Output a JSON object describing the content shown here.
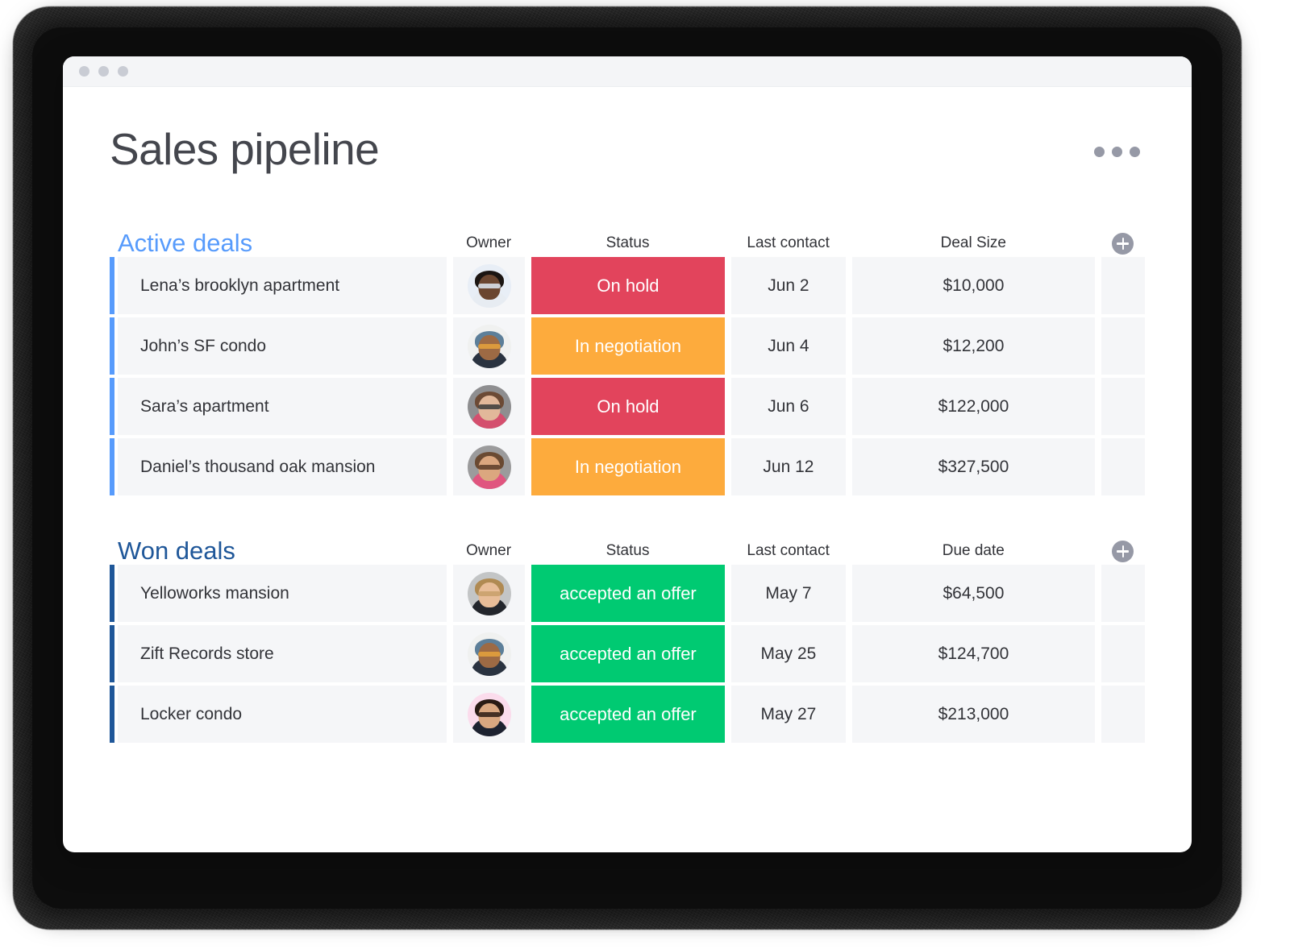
{
  "window": {
    "traffic_lights": [
      "close",
      "minimize",
      "maximize"
    ]
  },
  "header": {
    "title": "Sales pipeline",
    "menu_icon": "kebab-menu-icon"
  },
  "colors": {
    "active_accent": "#579bfc",
    "won_accent": "#1f5799",
    "status_on_hold": "#e2445c",
    "status_in_negotiation": "#fdab3d",
    "status_accepted": "#00ca72",
    "row_background": "#f5f6f8",
    "text": "#323338",
    "title_text": "#44464d",
    "icon_gray": "#9699a6"
  },
  "boards": [
    {
      "id": "active-deals",
      "title": "Active deals",
      "accent": "#579bfc",
      "add_label": "add-item-icon",
      "columns": [
        "Owner",
        "Status",
        "Last contact",
        "Deal Size"
      ],
      "rows": [
        {
          "name": "Lena’s brooklyn apartment",
          "owner": "owner-avatar-lena",
          "status": "On hold",
          "status_key": "onhold",
          "last_contact": "Jun 2",
          "value": "$10,000",
          "avatar": {
            "bg": "#e8eef6",
            "hair": "#1b1512",
            "face": "#6b4630",
            "body": "#e7ecf2",
            "acc": "#dfe9f2"
          }
        },
        {
          "name": "John’s SF condo",
          "owner": "owner-avatar-john",
          "status": "In negotiation",
          "status_key": "negot",
          "last_contact": "Jun 4",
          "value": "$12,200",
          "avatar": {
            "bg": "#f0f1f0",
            "hair": "#5d7f99",
            "face": "#9d6a44",
            "body": "#2a3340",
            "acc": "#e6a23c"
          }
        },
        {
          "name": "Sara’s apartment",
          "owner": "owner-avatar-sara",
          "status": "On hold",
          "status_key": "onhold",
          "last_contact": "Jun 6",
          "value": "$122,000",
          "avatar": {
            "bg": "#8e8e90",
            "hair": "#6c4a35",
            "face": "#e2b89a",
            "body": "#d44f6e",
            "acc": "#3b3b3b"
          }
        },
        {
          "name": "Daniel’s thousand oak mansion",
          "owner": "owner-avatar-daniel",
          "status": "In negotiation",
          "status_key": "negot",
          "last_contact": "Jun 12",
          "value": "$327,500",
          "avatar": {
            "bg": "#9b9b9c",
            "hair": "#6a4a32",
            "face": "#dba77f",
            "body": "#e0557f",
            "acc": "#5a3c28"
          }
        }
      ]
    },
    {
      "id": "won-deals",
      "title": "Won deals",
      "accent": "#1f5799",
      "add_label": "add-item-icon",
      "columns": [
        "Owner",
        "Status",
        "Last contact",
        "Due date"
      ],
      "rows": [
        {
          "name": "Yelloworks mansion",
          "owner": "owner-avatar-yelloworks",
          "status": "accepted an offer",
          "status_key": "accepted",
          "last_contact": "May 7",
          "value": "$64,500",
          "avatar": {
            "bg": "#c3c5c6",
            "hair": "#b08a52",
            "face": "#e8bd98",
            "body": "#23262c",
            "acc": "#c8a06a"
          }
        },
        {
          "name": "Zift Records store",
          "owner": "owner-avatar-zift",
          "status": "accepted an offer",
          "status_key": "accepted",
          "last_contact": "May 25",
          "value": "$124,700",
          "avatar": {
            "bg": "#f0f1f0",
            "hair": "#5d7f99",
            "face": "#9d6a44",
            "body": "#2a3340",
            "acc": "#e6a23c"
          }
        },
        {
          "name": "Locker condo",
          "owner": "owner-avatar-locker",
          "status": "accepted an offer",
          "status_key": "accepted",
          "last_contact": "May 27",
          "value": "$213,000",
          "avatar": {
            "bg": "#fbdcec",
            "hair": "#2a1b14",
            "face": "#d9a780",
            "body": "#1d2230",
            "acc": "#2a1b14"
          }
        }
      ]
    }
  ]
}
